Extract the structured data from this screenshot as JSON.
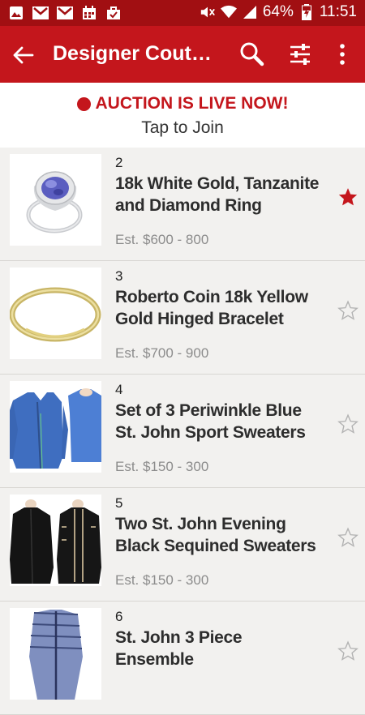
{
  "status_bar": {
    "battery": "64%",
    "time": "11:51",
    "icons": [
      "image-icon",
      "gmail-icon",
      "gmail-icon",
      "calendar-icon",
      "briefcase-icon",
      "mute-icon",
      "wifi-icon",
      "signal-icon",
      "battery-icon"
    ]
  },
  "app_bar": {
    "title": "Designer Coutur…",
    "icons": [
      "back-arrow-icon",
      "search-icon",
      "filter-sliders-icon",
      "more-vert-icon"
    ]
  },
  "banner": {
    "title": "AUCTION IS LIVE NOW!",
    "subtitle": "Tap to Join"
  },
  "colors": {
    "status_bar": "#a10f12",
    "app_bar": "#c4161c",
    "accent": "#c4161c"
  },
  "items": [
    {
      "lot": "2",
      "title": "18k White Gold, Tanzanite and Diamond Ring",
      "estimate": "Est. $600 - 800",
      "starred": true,
      "image": "ring"
    },
    {
      "lot": "3",
      "title": "Roberto Coin 18k Yellow Gold Hinged Bracelet",
      "estimate": "Est. $700 - 900",
      "starred": false,
      "image": "bracelet"
    },
    {
      "lot": "4",
      "title": "Set of 3 Periwinkle Blue St. John Sport Sweaters",
      "estimate": "Est. $150 - 300",
      "starred": false,
      "image": "blue-sweaters"
    },
    {
      "lot": "5",
      "title": "Two St. John Evening Black Sequined Sweaters",
      "estimate": "Est. $150 - 300",
      "starred": false,
      "image": "black-sweaters"
    },
    {
      "lot": "6",
      "title": "St. John 3 Piece Ensemble",
      "estimate": "",
      "starred": false,
      "image": "ensemble"
    }
  ]
}
